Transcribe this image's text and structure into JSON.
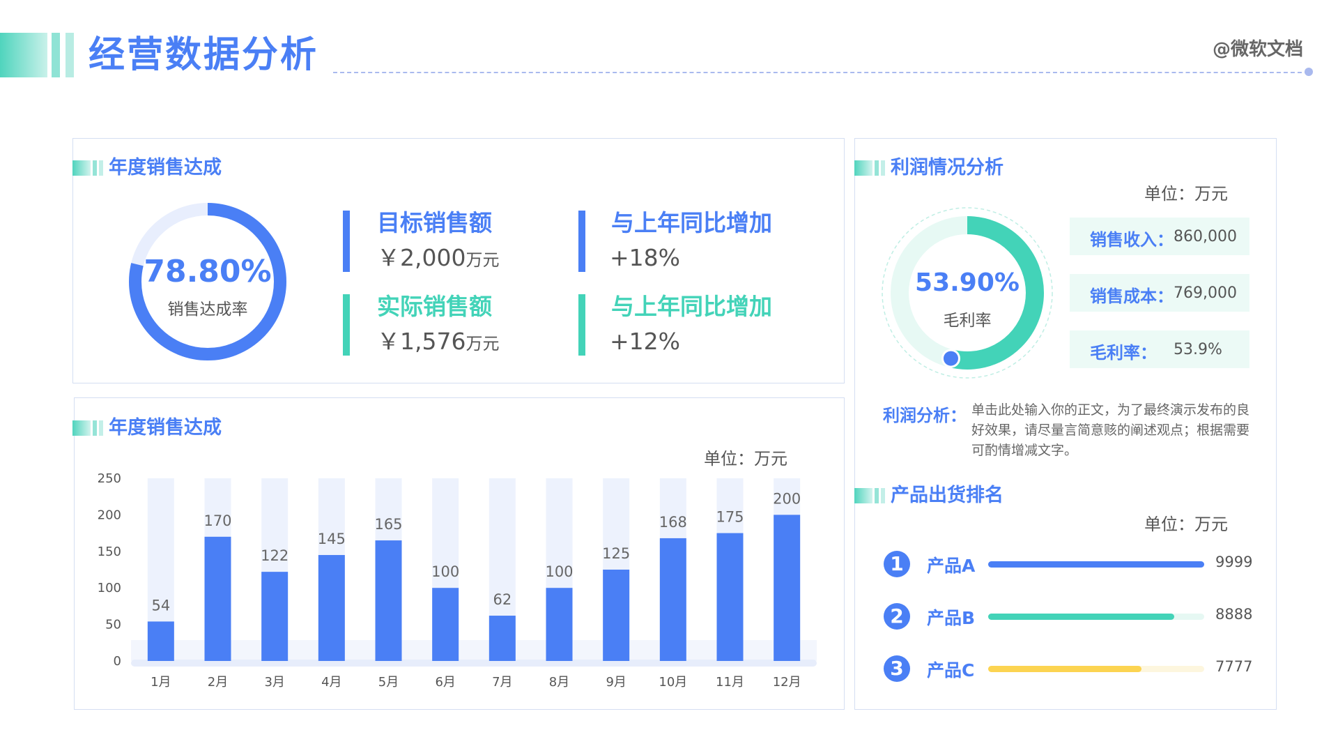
{
  "header": {
    "title": "经营数据分析",
    "brand": "@微软文档"
  },
  "annual": {
    "title": "年度销售达成",
    "rate_value": "78.80%",
    "rate_fraction": 0.788,
    "rate_label": "销售达成率",
    "target_label": "目标销售额",
    "target_value": "￥2,000",
    "target_unit": "万元",
    "actual_label": "实际销售额",
    "actual_value": "￥1,576",
    "actual_unit": "万元",
    "yoy_label_1": "与上年同比增加",
    "yoy_value_1": "+18%",
    "yoy_label_2": "与上年同比增加",
    "yoy_value_2": "+12%"
  },
  "monthly": {
    "title": "年度销售达成",
    "unit": "单位：万元"
  },
  "chart_data": {
    "type": "bar",
    "categories": [
      "1月",
      "2月",
      "3月",
      "4月",
      "5月",
      "6月",
      "7月",
      "8月",
      "9月",
      "10月",
      "11月",
      "12月"
    ],
    "values": [
      54,
      170,
      122,
      145,
      165,
      100,
      62,
      100,
      125,
      168,
      175,
      200
    ],
    "ylim": [
      0,
      250
    ],
    "yticks": [
      0,
      50,
      100,
      150,
      200,
      250
    ],
    "xlabel": "",
    "ylabel": "",
    "grid": false,
    "colors": {
      "bar": "#4a7ff5",
      "bar_background": "#edf2fd"
    }
  },
  "profit": {
    "title": "利润情况分析",
    "unit": "单位：万元",
    "margin_value": "53.90%",
    "margin_fraction": 0.539,
    "margin_label": "毛利率",
    "revenue_key": "销售收入：",
    "revenue_value": "860,000",
    "cost_key": "销售成本：",
    "cost_value": "769,000",
    "gross_key": "毛利率：",
    "gross_value": "53.9%",
    "analysis_key": "利润分析：",
    "analysis_text": "单击此处输入你的正文，为了最终演示发布的良好效果，请尽量言简意赅的阐述观点；根据需要可酌情增减文字。"
  },
  "ranking": {
    "title": "产品出货排名",
    "unit": "单位：万元",
    "items": [
      {
        "rank": "1",
        "name": "产品A",
        "value": "9999",
        "fraction": 1.0,
        "color": "#4a7ff5",
        "track": "#e6edfd"
      },
      {
        "rank": "2",
        "name": "产品B",
        "value": "8888",
        "fraction": 0.86,
        "color": "#43d3b8",
        "track": "#e6f8f3"
      },
      {
        "rank": "3",
        "name": "产品C",
        "value": "7777",
        "fraction": 0.71,
        "color": "#fcd451",
        "track": "#fdf6de"
      }
    ]
  },
  "colors": {
    "primary": "#4a7ff5",
    "teal": "#43d3b8",
    "yellow": "#fcd451"
  }
}
